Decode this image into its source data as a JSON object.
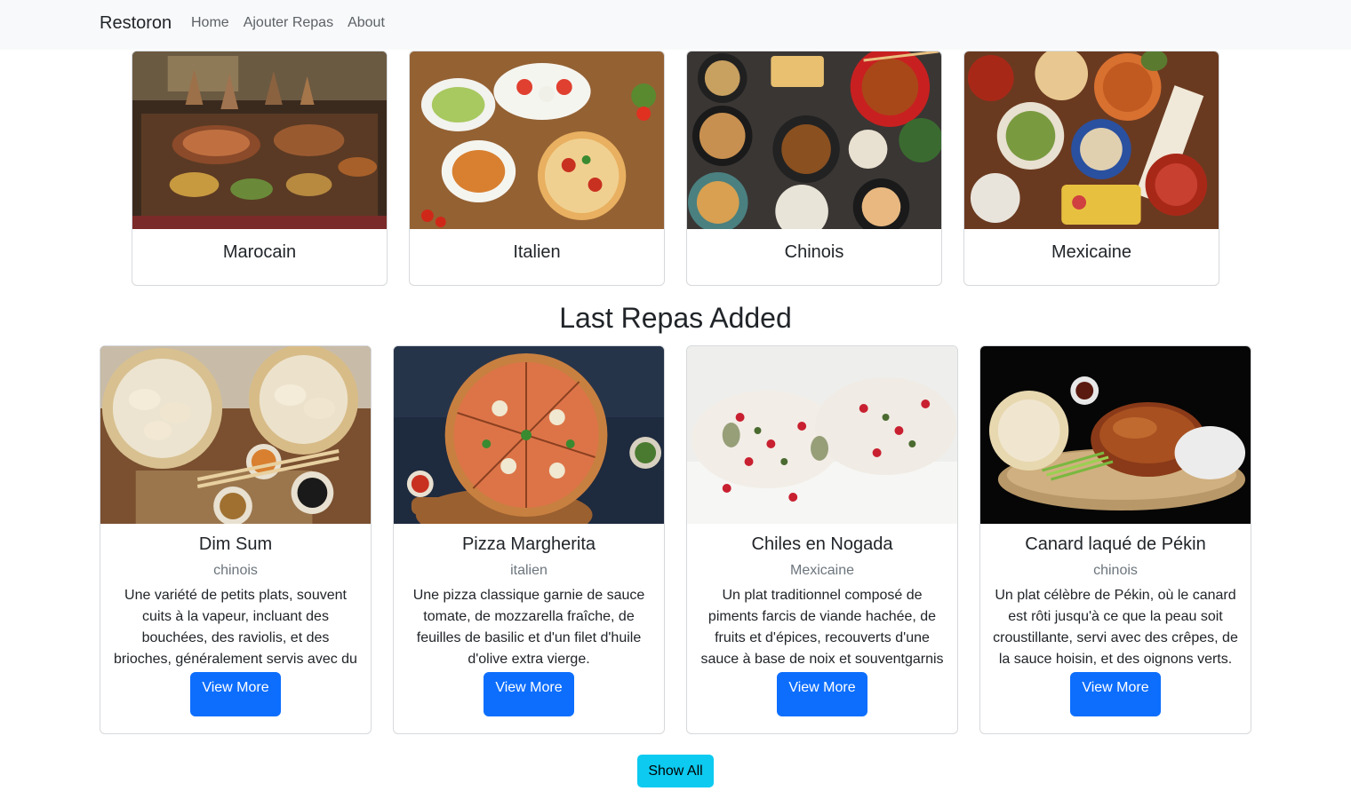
{
  "navbar": {
    "brand": "Restoron",
    "links": [
      "Home",
      "Ajouter Repas",
      "About"
    ]
  },
  "categories": [
    {
      "title": "Marocain",
      "image": "moroccan-feast-image"
    },
    {
      "title": "Italien",
      "image": "italian-feast-image"
    },
    {
      "title": "Chinois",
      "image": "chinese-feast-image"
    },
    {
      "title": "Mexicaine",
      "image": "mexican-feast-image"
    }
  ],
  "section": {
    "title": "Last Repas Added"
  },
  "repas": [
    {
      "name": "Dim Sum",
      "category": "chinois",
      "description": "Une variété de petits plats, souvent cuits à la vapeur, incluant des bouchées, des raviolis, et des brioches, généralement servis avec du thé.",
      "button": "View More",
      "image": "dim-sum-image"
    },
    {
      "name": "Pizza Margherita",
      "category": "italien",
      "description": "Une pizza classique garnie de sauce tomate, de mozzarella fraîche, de feuilles de basilic et d'un filet d'huile d'olive extra vierge.",
      "button": "View More",
      "image": "pizza-image"
    },
    {
      "name": "Chiles en Nogada",
      "category": "Mexicaine",
      "description": "Un plat traditionnel composé de piments farcis de viande hachée, de fruits et d'épices, recouverts d'une sauce à base de noix et souventgarnis",
      "button": "View More",
      "image": "chiles-image"
    },
    {
      "name": "Canard laqué de Pékin",
      "category": "chinois",
      "description": "Un plat célèbre de Pékin, où le canard est rôti jusqu'à ce que la peau soit croustillante, servi avec des crêpes, de la sauce hoisin, et des oignons verts.",
      "button": "View More",
      "image": "peking-duck-image"
    }
  ],
  "show_all": "Show All",
  "colors": {
    "primary": "#0d6efd",
    "info": "#0dcaf0",
    "navbar_bg": "#f8f9fa",
    "muted": "#6c757d"
  }
}
